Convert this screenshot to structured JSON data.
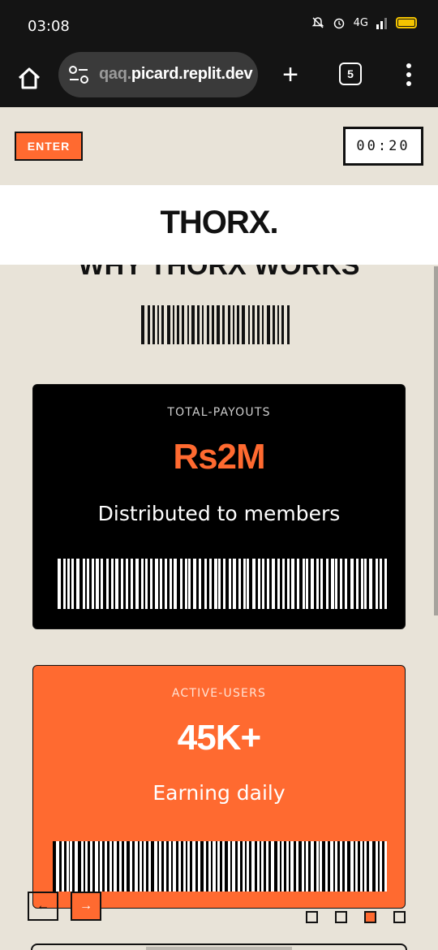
{
  "status_bar": {
    "time": "03:08",
    "network": "4G"
  },
  "browser": {
    "url_prefix": "qaq.",
    "url_domain": "picard.replit.dev",
    "tab_count": "5",
    "plus_label": "+"
  },
  "header": {
    "enter_label": "ENTER",
    "timer": "00:20",
    "brand": "THORX."
  },
  "section": {
    "title": "WHY THORX WORKS"
  },
  "cards": [
    {
      "label": "TOTAL-PAYOUTS",
      "value": "Rs2M",
      "desc": "Distributed to members",
      "value_color": "#ff6a30"
    },
    {
      "label": "ACTIVE-USERS",
      "value": "45K+",
      "desc": "Earning daily",
      "value_color": "#ffffff"
    }
  ],
  "carousel": {
    "prev_label": "←",
    "next_label": "→",
    "slide_count": 4,
    "active_index": 2
  },
  "colors": {
    "accent": "#ff6a30",
    "background": "#e8e3d8",
    "dark": "#000000"
  }
}
